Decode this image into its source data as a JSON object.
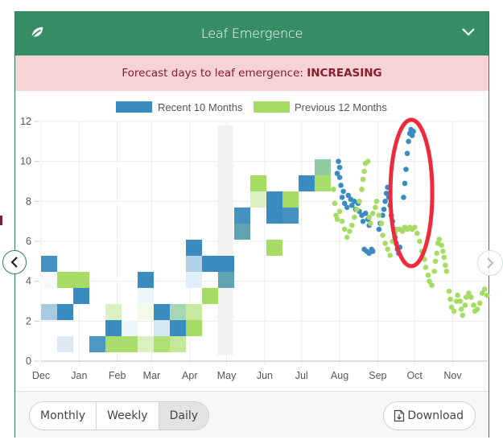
{
  "header": {
    "title": "Leaf Emergence",
    "icon": "leaf-icon",
    "collapse_icon": "chevron-down-icon"
  },
  "alert": {
    "prefix": "Forecast days to leaf emergence: ",
    "status": "INCREASING",
    "background": "#f5d3d6",
    "text_color": "#8a1c2c"
  },
  "footer": {
    "periods": [
      {
        "label": "Monthly",
        "active": false
      },
      {
        "label": "Weekly",
        "active": false
      },
      {
        "label": "Daily",
        "active": true
      }
    ],
    "download_label": "Download",
    "download_icon": "file-download-icon"
  },
  "nav": {
    "prev_icon": "chevron-left-icon",
    "next_icon": "chevron-right-icon"
  },
  "colors": {
    "header": "#378e66",
    "recent": "#3a8bbf",
    "previous": "#a6dc64",
    "annotation": "#ee2b3c"
  },
  "chart_data": {
    "type": "heatmap",
    "title": "",
    "xlabel": "",
    "ylabel": "",
    "ylim": [
      0,
      12
    ],
    "yticks": [
      0,
      2,
      4,
      6,
      8,
      10,
      12
    ],
    "xticks": [
      "Dec",
      "Jan",
      "Feb",
      "Mar",
      "Apr",
      "May",
      "Jun",
      "Jul",
      "Aug",
      "Sep",
      "Oct",
      "Nov"
    ],
    "x_units": "days since Dec 1",
    "xlim_days": [
      0,
      364
    ],
    "grid": true,
    "legend": {
      "placement": "top-center",
      "entries": [
        {
          "name": "Recent 10 Months",
          "color": "#3a8bbf"
        },
        {
          "name": "Previous 12 Months",
          "color": "#a6dc64"
        }
      ]
    },
    "highlight_band_day": 150,
    "heatmap_bin_days": 13,
    "heatmap_bin_value": 0.8,
    "heatmap_cells": [
      {
        "col": 0,
        "row": 5,
        "series": "recent",
        "intensity": 0.95
      },
      {
        "col": 0,
        "row": 4,
        "series": "recent",
        "intensity": 0.05
      },
      {
        "col": 0,
        "row": 2,
        "series": "recent",
        "intensity": 0.45
      },
      {
        "col": 1,
        "row": 4,
        "series": "previous",
        "intensity": 1.0
      },
      {
        "col": 1,
        "row": 2,
        "series": "recent",
        "intensity": 1.0
      },
      {
        "col": 1,
        "row": 0,
        "series": "recent",
        "intensity": 0.18
      },
      {
        "col": 2,
        "row": 4,
        "series": "previous",
        "intensity": 1.0
      },
      {
        "col": 2,
        "row": 3,
        "series": "recent",
        "intensity": 1.0
      },
      {
        "col": 3,
        "row": 0,
        "series": "recent",
        "intensity": 0.9
      },
      {
        "col": 4,
        "row": 2,
        "series": "previous",
        "intensity": 0.4
      },
      {
        "col": 4,
        "row": 1,
        "series": "recent",
        "intensity": 1.0
      },
      {
        "col": 4,
        "row": 0,
        "series": "previous",
        "intensity": 0.95
      },
      {
        "col": 5,
        "row": 1,
        "series": "recent",
        "intensity": 0.08
      },
      {
        "col": 5,
        "row": 0,
        "series": "previous",
        "intensity": 0.95
      },
      {
        "col": 6,
        "row": 4,
        "series": "recent",
        "intensity": 1.0
      },
      {
        "col": 6,
        "row": 3,
        "series": "recent",
        "intensity": 0.08
      },
      {
        "col": 6,
        "row": 2,
        "series": "previous",
        "intensity": 0.15
      },
      {
        "col": 6,
        "row": 0,
        "series": "previous",
        "intensity": 0.4
      },
      {
        "col": 7,
        "row": 2,
        "series": "recent",
        "intensity": 1.0
      },
      {
        "col": 7,
        "row": 1,
        "series": "recent",
        "intensity": 0.2
      },
      {
        "col": 7,
        "row": 0,
        "series": "previous",
        "intensity": 0.9
      },
      {
        "col": 8,
        "row": 2,
        "series": "mixed",
        "intensity": 0.6
      },
      {
        "col": 8,
        "row": 1,
        "series": "recent",
        "intensity": 1.0
      },
      {
        "col": 8,
        "row": 0,
        "series": "previous",
        "intensity": 0.65
      },
      {
        "col": 9,
        "row": 6,
        "series": "recent",
        "intensity": 1.0
      },
      {
        "col": 9,
        "row": 5,
        "series": "recent",
        "intensity": 0.4
      },
      {
        "col": 9,
        "row": 4,
        "series": "recent",
        "intensity": 0.15
      },
      {
        "col": 9,
        "row": 2,
        "series": "previous",
        "intensity": 0.6
      },
      {
        "col": 9,
        "row": 1,
        "series": "previous",
        "intensity": 1.0
      },
      {
        "col": 10,
        "row": 5,
        "series": "recent",
        "intensity": 1.0
      },
      {
        "col": 10,
        "row": 3,
        "series": "previous",
        "intensity": 1.0
      },
      {
        "col": 11,
        "row": 5,
        "series": "recent",
        "intensity": 1.0
      },
      {
        "col": 11,
        "row": 4,
        "series": "teal",
        "intensity": 0.9
      },
      {
        "col": 12,
        "row": 7,
        "series": "teal",
        "intensity": 0.9
      },
      {
        "col": 12,
        "row": 8,
        "series": "recent",
        "intensity": 0.95
      },
      {
        "col": 13,
        "row": 10,
        "series": "previous",
        "intensity": 1.0
      },
      {
        "col": 13,
        "row": 9,
        "series": "previous",
        "intensity": 0.4
      },
      {
        "col": 14,
        "row": 9,
        "series": "recent",
        "intensity": 1.0
      },
      {
        "col": 14,
        "row": 8,
        "series": "recent",
        "intensity": 1.0
      },
      {
        "col": 14,
        "row": 6,
        "series": "previous",
        "intensity": 1.0
      },
      {
        "col": 15,
        "row": 9,
        "series": "previous",
        "intensity": 1.0
      },
      {
        "col": 15,
        "row": 8,
        "series": "recent",
        "intensity": 0.95
      },
      {
        "col": 16,
        "row": 10,
        "series": "recent",
        "intensity": 1.0
      },
      {
        "col": 17,
        "row": 11,
        "series": "mixed",
        "intensity": 0.75
      },
      {
        "col": 17,
        "row": 10,
        "series": "previous",
        "intensity": 0.95
      }
    ],
    "scatter_series": [
      {
        "name": "Recent 10 Months",
        "color": "#3a8bbf",
        "points": [
          [
            242,
            10.0
          ],
          [
            243,
            9.7
          ],
          [
            241,
            9.4
          ],
          [
            243,
            9.2
          ],
          [
            244,
            8.8
          ],
          [
            246,
            8.5
          ],
          [
            245,
            8.2
          ],
          [
            247,
            7.9
          ],
          [
            249,
            7.7
          ],
          [
            250,
            8.3
          ],
          [
            252,
            8.1
          ],
          [
            253,
            7.8
          ],
          [
            255,
            8.0
          ],
          [
            256,
            7.6
          ],
          [
            258,
            7.9
          ],
          [
            259,
            7.5
          ],
          [
            261,
            7.3
          ],
          [
            262,
            7.0
          ],
          [
            264,
            7.4
          ],
          [
            266,
            7.1
          ],
          [
            267,
            6.8
          ],
          [
            263,
            5.6
          ],
          [
            265,
            5.5
          ],
          [
            267,
            5.4
          ],
          [
            269,
            5.6
          ],
          [
            270,
            5.5
          ],
          [
            275,
            6.6
          ],
          [
            276,
            6.9
          ],
          [
            278,
            7.3
          ],
          [
            279,
            7.6
          ],
          [
            280,
            8.0
          ],
          [
            281,
            8.4
          ],
          [
            282,
            8.7
          ],
          [
            283,
            8.2
          ],
          [
            284,
            7.8
          ],
          [
            285,
            7.3
          ],
          [
            286,
            7.0
          ],
          [
            287,
            6.6
          ],
          [
            288,
            6.2
          ],
          [
            289,
            5.9
          ],
          [
            290,
            5.6
          ],
          [
            291,
            5.4
          ],
          [
            292,
            5.7
          ],
          [
            295,
            8.2
          ],
          [
            296,
            8.9
          ],
          [
            297,
            9.6
          ],
          [
            298,
            10.4
          ],
          [
            299,
            11.0
          ],
          [
            300,
            11.4
          ],
          [
            301,
            11.6
          ],
          [
            302,
            11.3
          ],
          [
            303,
            11.5
          ]
        ]
      },
      {
        "name": "Previous 12 Months",
        "color": "#a6dc64",
        "points": [
          [
            238,
            8.6
          ],
          [
            239,
            7.9
          ],
          [
            240,
            7.3
          ],
          [
            241,
            7.1
          ],
          [
            243,
            7.5
          ],
          [
            245,
            7.0
          ],
          [
            247,
            6.6
          ],
          [
            249,
            6.2
          ],
          [
            251,
            6.5
          ],
          [
            253,
            6.8
          ],
          [
            255,
            7.2
          ],
          [
            257,
            7.6
          ],
          [
            259,
            8.0
          ],
          [
            261,
            8.6
          ],
          [
            262,
            9.1
          ],
          [
            263,
            9.5
          ],
          [
            264,
            9.9
          ],
          [
            266,
            10.0
          ],
          [
            267,
            7.2
          ],
          [
            268,
            6.9
          ],
          [
            270,
            7.4
          ],
          [
            272,
            7.7
          ],
          [
            273,
            8.0
          ],
          [
            275,
            7.3
          ],
          [
            277,
            6.9
          ],
          [
            278,
            6.3
          ],
          [
            280,
            5.9
          ],
          [
            282,
            5.6
          ],
          [
            284,
            5.3
          ],
          [
            286,
            6.0
          ],
          [
            288,
            6.4
          ],
          [
            290,
            6.6
          ],
          [
            292,
            6.6
          ],
          [
            294,
            6.5
          ],
          [
            296,
            6.7
          ],
          [
            298,
            6.6
          ],
          [
            300,
            6.7
          ],
          [
            302,
            6.6
          ],
          [
            304,
            6.7
          ],
          [
            306,
            6.4
          ],
          [
            308,
            6.0
          ],
          [
            310,
            5.5
          ],
          [
            312,
            5.1
          ],
          [
            313,
            4.7
          ],
          [
            315,
            4.3
          ],
          [
            316,
            4.0
          ],
          [
            318,
            3.8
          ],
          [
            320,
            4.5
          ],
          [
            321,
            5.0
          ],
          [
            322,
            5.4
          ],
          [
            323,
            5.9
          ],
          [
            324,
            6.1
          ],
          [
            326,
            5.8
          ],
          [
            327,
            5.5
          ],
          [
            328,
            5.2
          ],
          [
            329,
            4.8
          ],
          [
            330,
            4.5
          ],
          [
            332,
            3.5
          ],
          [
            333,
            3.1
          ],
          [
            334,
            2.7
          ],
          [
            336,
            2.5
          ],
          [
            338,
            3.0
          ],
          [
            339,
            3.3
          ],
          [
            341,
            3.0
          ],
          [
            342,
            2.6
          ],
          [
            343,
            2.3
          ],
          [
            345,
            2.8
          ],
          [
            346,
            3.2
          ],
          [
            348,
            3.4
          ],
          [
            350,
            3.2
          ],
          [
            352,
            2.8
          ],
          [
            353,
            2.5
          ],
          [
            355,
            2.6
          ],
          [
            357,
            2.9
          ],
          [
            359,
            3.4
          ],
          [
            361,
            3.6
          ],
          [
            363,
            3.3
          ]
        ]
      }
    ],
    "annotation": {
      "type": "ellipse",
      "color": "#ee2b3c",
      "center_day": 300,
      "center_value": 8.5,
      "note": "highlight of recent rising values"
    }
  }
}
